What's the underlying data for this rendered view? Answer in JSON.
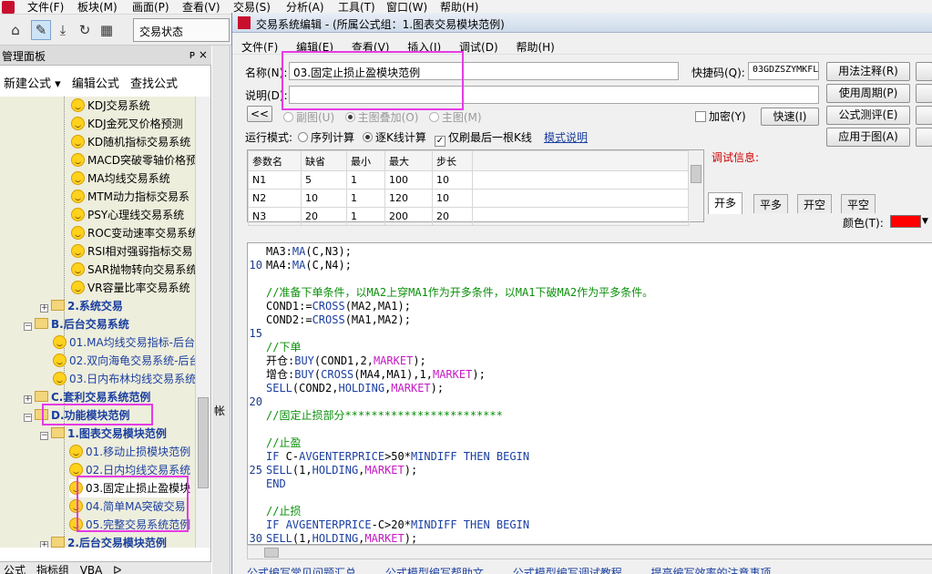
{
  "app": {
    "menu": [
      "文件(F)",
      "板块(M)",
      "画面(P)",
      "查看(V)",
      "分析(A)",
      "工具(T)",
      "窗口(W)",
      "帮助(H)"
    ],
    "menu_partial": "交易(S)",
    "status_combo": "交易状态"
  },
  "panel": {
    "title": "管理面板",
    "pin": "ᴘ ×",
    "actions": [
      "新建公式 ▾",
      "编辑公式",
      "查找公式"
    ],
    "tree": [
      {
        "label": "KDJ交易系统",
        "kind": "formula"
      },
      {
        "label": "KDJ金死叉价格预测",
        "kind": "formula"
      },
      {
        "label": "KD随机指标交易系统",
        "kind": "formula"
      },
      {
        "label": "MACD突破零轴价格预",
        "kind": "formula"
      },
      {
        "label": "MA均线交易系统",
        "kind": "formula"
      },
      {
        "label": "MTM动力指标交易系",
        "kind": "formula"
      },
      {
        "label": "PSY心理线交易系统",
        "kind": "formula"
      },
      {
        "label": "ROC变动速率交易系统",
        "kind": "formula"
      },
      {
        "label": "RSI相对强弱指标交易",
        "kind": "formula"
      },
      {
        "label": "SAR抛物转向交易系统",
        "kind": "formula"
      },
      {
        "label": "VR容量比率交易系统",
        "kind": "formula"
      },
      {
        "label": "2.系统交易",
        "kind": "folder"
      },
      {
        "label": "B.后台交易系统",
        "kind": "folder"
      },
      {
        "label": "01.MA均线交易指标-后台",
        "kind": "link"
      },
      {
        "label": "02.双向海龟交易系统-后台",
        "kind": "link"
      },
      {
        "label": "03.日内布林均线交易系统",
        "kind": "link"
      },
      {
        "label": "C.套利交易系统范例",
        "kind": "folder"
      },
      {
        "label": "D.功能模块范例",
        "kind": "folder"
      },
      {
        "label": "1.图表交易模块范例",
        "kind": "folder"
      },
      {
        "label": "01.移动止损模块范例",
        "kind": "link"
      },
      {
        "label": "02.日内均线交易系统",
        "kind": "link"
      },
      {
        "label": "03.固定止损止盈模块",
        "kind": "formula"
      },
      {
        "label": "04.简单MA突破交易",
        "kind": "link"
      },
      {
        "label": "05.完整交易系统范例",
        "kind": "link"
      },
      {
        "label": "2.后台交易模块范例",
        "kind": "folder"
      }
    ],
    "bottom_tabs": [
      "公式",
      "指标组",
      "VBA",
      "ᐅ"
    ]
  },
  "behind": {
    "label": "帐"
  },
  "dialog": {
    "title": "交易系统编辑 - (所属公式组：1.图表交易模块范例)",
    "menu": [
      "文件(F)",
      "编辑(E)",
      "查看(V)",
      "插入(I)",
      "调试(D)",
      "帮助(H)"
    ],
    "name_label": "名称(N):",
    "name_value": "03.固定止损止盈模块范例",
    "desc_label": "说明(D):",
    "desc_value": "",
    "shortcut_label": "快捷码(Q):",
    "shortcut_value": "03GDZSZYMKFL",
    "collapse_btn": "<<",
    "chart_opts": [
      "副图(U)",
      "主图叠加(O)",
      "主图(M)"
    ],
    "encrypt_label": "加密(Y)",
    "quick_btn": "快速(I)",
    "run_mode_label": "运行模式:",
    "run_modes": [
      "序列计算",
      "逐K线计算"
    ],
    "last_bar_label": "仅刷最后一根K线",
    "mode_help_link": "模式说明",
    "side_buttons": [
      "用法注释(R)",
      "使用周期(P)",
      "公式测评(E)",
      "应用于图(A)"
    ],
    "params": {
      "headers": [
        "参数名",
        "缺省",
        "最小",
        "最大",
        "步长"
      ],
      "rows": [
        [
          "N1",
          "5",
          "1",
          "100",
          "10"
        ],
        [
          "N2",
          "10",
          "1",
          "120",
          "10"
        ],
        [
          "N3",
          "20",
          "1",
          "200",
          "20"
        ]
      ]
    },
    "debug_label": "调试信息:",
    "debug_tabs": [
      "开多",
      "平多",
      "开空",
      "平空"
    ],
    "color_label": "颜色(T):",
    "color_value": "#ff0000",
    "code_lines": [
      {
        "n": "",
        "t": "MA3:MA(C,N3);"
      },
      {
        "n": "10",
        "t": "MA4:MA(C,N4);"
      },
      {
        "n": "",
        "t": ""
      },
      {
        "n": "",
        "t": "//准备下单条件，以MA2上穿MA1作为开多条件，以MA1下破MA2作为平多条件。"
      },
      {
        "n": "",
        "t": "COND1:=CROSS(MA2,MA1);"
      },
      {
        "n": "",
        "t": "COND2:=CROSS(MA1,MA2);"
      },
      {
        "n": "15",
        "t": ""
      },
      {
        "n": "",
        "t": "//下单"
      },
      {
        "n": "",
        "t": "开仓:BUY(COND1,2,MARKET);"
      },
      {
        "n": "",
        "t": "增仓:BUY(CROSS(MA4,MA1),1,MARKET);"
      },
      {
        "n": "",
        "t": "SELL(COND2,HOLDING,MARKET);"
      },
      {
        "n": "20",
        "t": ""
      },
      {
        "n": "",
        "t": "//固定止损部分************************"
      },
      {
        "n": "",
        "t": ""
      },
      {
        "n": "",
        "t": "//止盈"
      },
      {
        "n": "",
        "t": "IF C-AVGENTERPRICE>50*MINDIFF THEN BEGIN"
      },
      {
        "n": "25",
        "t": "SELL(1,HOLDING,MARKET);"
      },
      {
        "n": "",
        "t": "END"
      },
      {
        "n": "",
        "t": ""
      },
      {
        "n": "",
        "t": "//止损"
      },
      {
        "n": "",
        "t": "IF AVGENTERPRICE-C>20*MINDIFF THEN BEGIN"
      },
      {
        "n": "30",
        "t": "SELL(1,HOLDING,MARKET);"
      }
    ],
    "footer_links": [
      "公式编写常见问题汇总",
      "公式模型编写帮助文",
      "公式模型编写调试教程",
      "提高编写效率的注意事项"
    ]
  }
}
